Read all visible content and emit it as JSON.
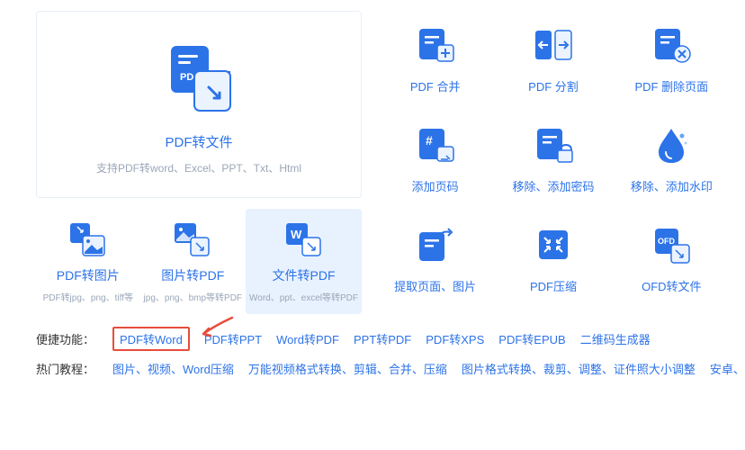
{
  "hero": {
    "title": "PDF转文件",
    "subtitle": "支持PDF转word、Excel、PPT、Txt、Html"
  },
  "sub_cards": [
    {
      "title": "PDF转图片",
      "desc": "PDF转jpg、png、tiff等"
    },
    {
      "title": "图片转PDF",
      "desc": "jpg、png、bmp等转PDF"
    },
    {
      "title": "文件转PDF",
      "desc": "Word、ppt、excel等转PDF"
    }
  ],
  "tools": [
    {
      "label": "PDF 合并"
    },
    {
      "label": "PDF 分割"
    },
    {
      "label": "PDF 删除页面"
    },
    {
      "label": "添加页码"
    },
    {
      "label": "移除、添加密码"
    },
    {
      "label": "移除、添加水印"
    },
    {
      "label": "提取页面、图片"
    },
    {
      "label": "PDF压缩"
    },
    {
      "label": "OFD转文件"
    }
  ],
  "quick": {
    "label": "便捷功能：",
    "links": [
      "PDF转Word",
      "PDF转PPT",
      "Word转PDF",
      "PPT转PDF",
      "PDF转XPS",
      "PDF转EPUB",
      "二维码生成器"
    ]
  },
  "hot": {
    "label": "热门教程：",
    "links": [
      "图片、视频、Word压缩",
      "万能视频格式转换、剪辑、合并、压缩",
      "图片格式转换、裁剪、调整、证件照大小调整",
      "安卓、苹果手机投屏到"
    ]
  }
}
